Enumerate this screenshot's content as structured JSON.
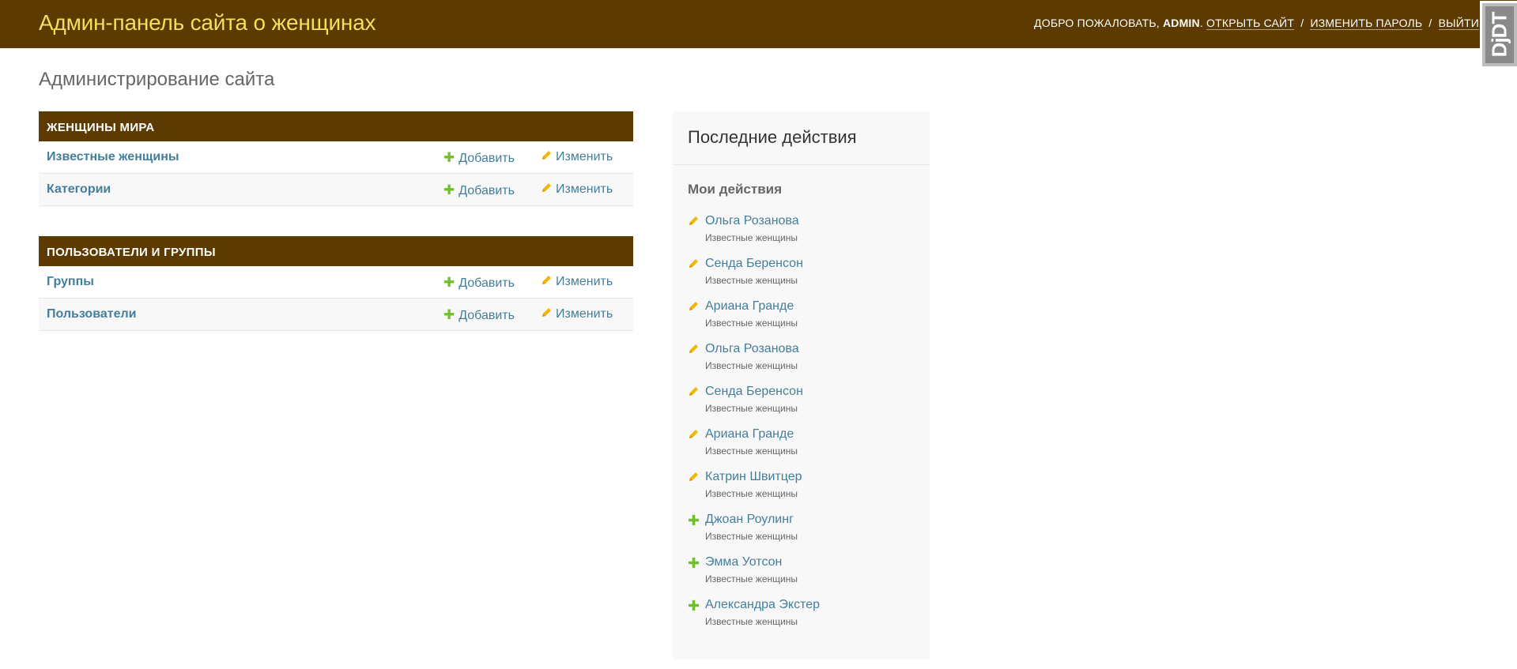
{
  "header": {
    "site_title": "Админ-панель сайта о женщинах",
    "welcome": "Добро пожаловать,",
    "username": "admin",
    "view_site": "Открыть сайт",
    "change_password": "Изменить пароль",
    "logout": "Выйти",
    "separator": "/"
  },
  "toolbar_handle": {
    "label": "DjDT"
  },
  "page_title": "Администрирование сайта",
  "modules": [
    {
      "caption": "Женщины мира",
      "models": [
        {
          "name": "Известные женщины",
          "add": "Добавить",
          "change": "Изменить"
        },
        {
          "name": "Категории",
          "add": "Добавить",
          "change": "Изменить"
        }
      ]
    },
    {
      "caption": "Пользователи и группы",
      "models": [
        {
          "name": "Группы",
          "add": "Добавить",
          "change": "Изменить"
        },
        {
          "name": "Пользователи",
          "add": "Добавить",
          "change": "Изменить"
        }
      ]
    }
  ],
  "recent_actions": {
    "title": "Последние действия",
    "subtitle": "Мои действия",
    "items": [
      {
        "icon": "pencil-icon",
        "name": "Ольга Розанова",
        "type": "Известные женщины"
      },
      {
        "icon": "pencil-icon",
        "name": "Сенда Беренсон",
        "type": "Известные женщины"
      },
      {
        "icon": "pencil-icon",
        "name": "Ариана Гранде",
        "type": "Известные женщины"
      },
      {
        "icon": "pencil-icon",
        "name": "Ольга Розанова",
        "type": "Известные женщины"
      },
      {
        "icon": "pencil-icon",
        "name": "Сенда Беренсон",
        "type": "Известные женщины"
      },
      {
        "icon": "pencil-icon",
        "name": "Ариана Гранде",
        "type": "Известные женщины"
      },
      {
        "icon": "pencil-icon",
        "name": "Катрин Швитцер",
        "type": "Известные женщины"
      },
      {
        "icon": "plus-icon",
        "name": "Джоан Роулинг",
        "type": "Известные женщины"
      },
      {
        "icon": "plus-icon",
        "name": "Эмма Уотсон",
        "type": "Известные женщины"
      },
      {
        "icon": "plus-icon",
        "name": "Александра Экстер",
        "type": "Известные женщины"
      }
    ]
  },
  "colors": {
    "header_bg": "#5c3a00",
    "site_title": "#f5dd5d",
    "link": "#447e9b",
    "add_icon": "#70bf2b",
    "change_icon": "#efb80b"
  }
}
